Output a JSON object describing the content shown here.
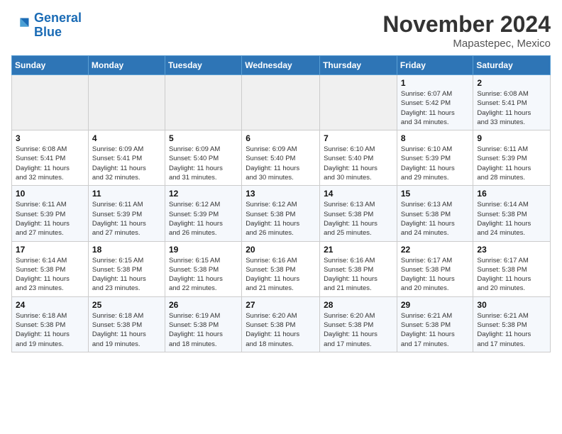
{
  "logo": {
    "line1": "General",
    "line2": "Blue"
  },
  "title": "November 2024",
  "location": "Mapastepec, Mexico",
  "days_header": [
    "Sunday",
    "Monday",
    "Tuesday",
    "Wednesday",
    "Thursday",
    "Friday",
    "Saturday"
  ],
  "weeks": [
    [
      {
        "num": "",
        "info": ""
      },
      {
        "num": "",
        "info": ""
      },
      {
        "num": "",
        "info": ""
      },
      {
        "num": "",
        "info": ""
      },
      {
        "num": "",
        "info": ""
      },
      {
        "num": "1",
        "info": "Sunrise: 6:07 AM\nSunset: 5:42 PM\nDaylight: 11 hours\nand 34 minutes."
      },
      {
        "num": "2",
        "info": "Sunrise: 6:08 AM\nSunset: 5:41 PM\nDaylight: 11 hours\nand 33 minutes."
      }
    ],
    [
      {
        "num": "3",
        "info": "Sunrise: 6:08 AM\nSunset: 5:41 PM\nDaylight: 11 hours\nand 32 minutes."
      },
      {
        "num": "4",
        "info": "Sunrise: 6:09 AM\nSunset: 5:41 PM\nDaylight: 11 hours\nand 32 minutes."
      },
      {
        "num": "5",
        "info": "Sunrise: 6:09 AM\nSunset: 5:40 PM\nDaylight: 11 hours\nand 31 minutes."
      },
      {
        "num": "6",
        "info": "Sunrise: 6:09 AM\nSunset: 5:40 PM\nDaylight: 11 hours\nand 30 minutes."
      },
      {
        "num": "7",
        "info": "Sunrise: 6:10 AM\nSunset: 5:40 PM\nDaylight: 11 hours\nand 30 minutes."
      },
      {
        "num": "8",
        "info": "Sunrise: 6:10 AM\nSunset: 5:39 PM\nDaylight: 11 hours\nand 29 minutes."
      },
      {
        "num": "9",
        "info": "Sunrise: 6:11 AM\nSunset: 5:39 PM\nDaylight: 11 hours\nand 28 minutes."
      }
    ],
    [
      {
        "num": "10",
        "info": "Sunrise: 6:11 AM\nSunset: 5:39 PM\nDaylight: 11 hours\nand 27 minutes."
      },
      {
        "num": "11",
        "info": "Sunrise: 6:11 AM\nSunset: 5:39 PM\nDaylight: 11 hours\nand 27 minutes."
      },
      {
        "num": "12",
        "info": "Sunrise: 6:12 AM\nSunset: 5:39 PM\nDaylight: 11 hours\nand 26 minutes."
      },
      {
        "num": "13",
        "info": "Sunrise: 6:12 AM\nSunset: 5:38 PM\nDaylight: 11 hours\nand 26 minutes."
      },
      {
        "num": "14",
        "info": "Sunrise: 6:13 AM\nSunset: 5:38 PM\nDaylight: 11 hours\nand 25 minutes."
      },
      {
        "num": "15",
        "info": "Sunrise: 6:13 AM\nSunset: 5:38 PM\nDaylight: 11 hours\nand 24 minutes."
      },
      {
        "num": "16",
        "info": "Sunrise: 6:14 AM\nSunset: 5:38 PM\nDaylight: 11 hours\nand 24 minutes."
      }
    ],
    [
      {
        "num": "17",
        "info": "Sunrise: 6:14 AM\nSunset: 5:38 PM\nDaylight: 11 hours\nand 23 minutes."
      },
      {
        "num": "18",
        "info": "Sunrise: 6:15 AM\nSunset: 5:38 PM\nDaylight: 11 hours\nand 23 minutes."
      },
      {
        "num": "19",
        "info": "Sunrise: 6:15 AM\nSunset: 5:38 PM\nDaylight: 11 hours\nand 22 minutes."
      },
      {
        "num": "20",
        "info": "Sunrise: 6:16 AM\nSunset: 5:38 PM\nDaylight: 11 hours\nand 21 minutes."
      },
      {
        "num": "21",
        "info": "Sunrise: 6:16 AM\nSunset: 5:38 PM\nDaylight: 11 hours\nand 21 minutes."
      },
      {
        "num": "22",
        "info": "Sunrise: 6:17 AM\nSunset: 5:38 PM\nDaylight: 11 hours\nand 20 minutes."
      },
      {
        "num": "23",
        "info": "Sunrise: 6:17 AM\nSunset: 5:38 PM\nDaylight: 11 hours\nand 20 minutes."
      }
    ],
    [
      {
        "num": "24",
        "info": "Sunrise: 6:18 AM\nSunset: 5:38 PM\nDaylight: 11 hours\nand 19 minutes."
      },
      {
        "num": "25",
        "info": "Sunrise: 6:18 AM\nSunset: 5:38 PM\nDaylight: 11 hours\nand 19 minutes."
      },
      {
        "num": "26",
        "info": "Sunrise: 6:19 AM\nSunset: 5:38 PM\nDaylight: 11 hours\nand 18 minutes."
      },
      {
        "num": "27",
        "info": "Sunrise: 6:20 AM\nSunset: 5:38 PM\nDaylight: 11 hours\nand 18 minutes."
      },
      {
        "num": "28",
        "info": "Sunrise: 6:20 AM\nSunset: 5:38 PM\nDaylight: 11 hours\nand 17 minutes."
      },
      {
        "num": "29",
        "info": "Sunrise: 6:21 AM\nSunset: 5:38 PM\nDaylight: 11 hours\nand 17 minutes."
      },
      {
        "num": "30",
        "info": "Sunrise: 6:21 AM\nSunset: 5:38 PM\nDaylight: 11 hours\nand 17 minutes."
      }
    ]
  ]
}
